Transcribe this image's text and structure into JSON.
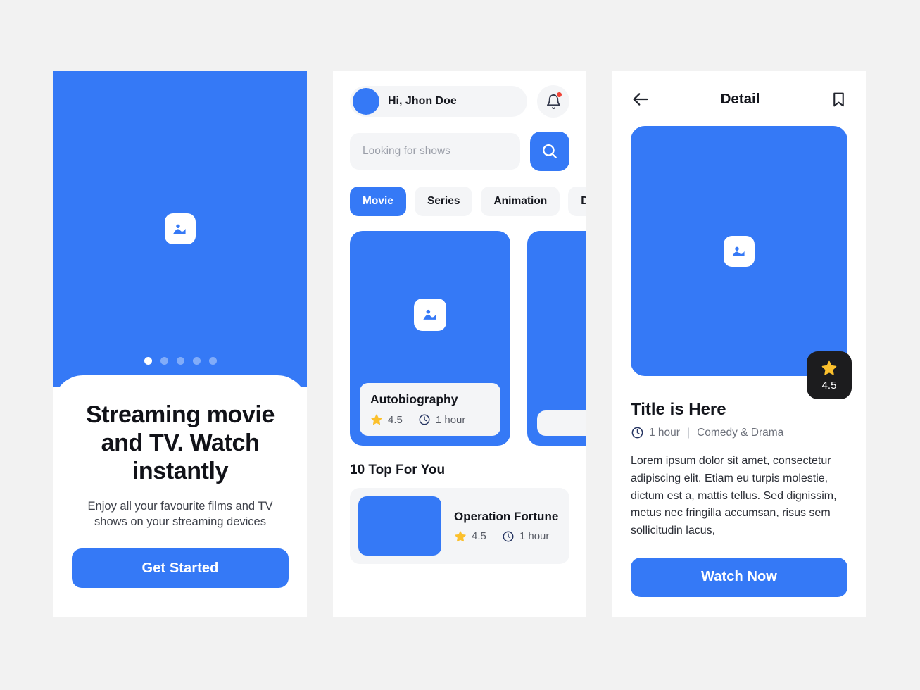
{
  "theme": {
    "accent": "#3579f6",
    "page_bg": "#f2f2f2",
    "surface": "#ffffff",
    "muted_surface": "#f4f5f7",
    "star": "#fbc02d",
    "badge_bg": "#1c1c1e",
    "notification_dot": "#f04438"
  },
  "onboarding": {
    "hero_image_icon": "image-placeholder-icon",
    "dots": [
      {
        "active": true
      },
      {
        "active": false
      },
      {
        "active": false
      },
      {
        "active": false
      },
      {
        "active": false
      }
    ],
    "title": "Streaming movie and TV. Watch instantly",
    "subtitle": "Enjoy all your favourite films and TV shows on your streaming devices",
    "cta_label": "Get Started"
  },
  "home": {
    "greeting": "Hi, Jhon Doe",
    "avatar_icon": "avatar",
    "notification_icon": "bell-icon",
    "notification_has_unread": true,
    "search": {
      "placeholder": "Looking for shows",
      "value": "",
      "button_icon": "search-icon"
    },
    "categories": [
      {
        "label": "Movie",
        "active": true
      },
      {
        "label": "Series",
        "active": false
      },
      {
        "label": "Animation",
        "active": false
      },
      {
        "label": "Docum",
        "active": false
      }
    ],
    "carousel": [
      {
        "title": "Autobiography",
        "rating": "4.5",
        "duration": "1 hour",
        "image_icon": "image-placeholder-icon"
      },
      {
        "title": "",
        "rating": "",
        "duration": "",
        "image_icon": "image-placeholder-icon"
      }
    ],
    "top_section_title": "10 Top For You",
    "top_items": [
      {
        "title": "Operation Fortune",
        "rating": "4.5",
        "duration": "1 hour"
      }
    ]
  },
  "detail": {
    "back_icon": "arrow-left-icon",
    "title": "Detail",
    "bookmark_icon": "bookmark-icon",
    "poster_image_icon": "image-placeholder-icon",
    "rating_badge": {
      "icon": "star-icon",
      "value": "4.5"
    },
    "movie_title": "Title is Here",
    "duration": "1 hour",
    "separator": "|",
    "genre": "Comedy & Drama",
    "description": "Lorem ipsum dolor sit amet, consectetur adipiscing elit. Etiam eu turpis molestie, dictum est a, mattis tellus. Sed dignissim, metus nec fringilla accumsan, risus sem sollicitudin lacus,",
    "cta_label": "Watch Now"
  }
}
